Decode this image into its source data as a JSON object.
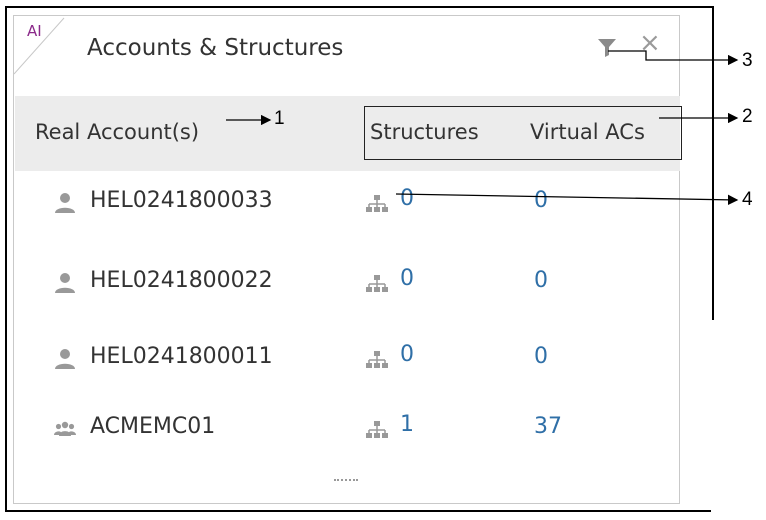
{
  "widget": {
    "badge": "AI",
    "title": "Accounts & Structures"
  },
  "header": {
    "real_accounts": "Real Account(s)",
    "structures": "Structures",
    "virtual_acs": "Virtual ACs"
  },
  "rows": [
    {
      "account": "HEL0241800033",
      "icon": "user-icon",
      "structures": "0",
      "virtual": "0"
    },
    {
      "account": "HEL0241800022",
      "icon": "user-icon",
      "structures": "0",
      "virtual": "0"
    },
    {
      "account": "HEL0241800011",
      "icon": "user-icon",
      "structures": "0",
      "virtual": "0"
    },
    {
      "account": "ACMEMC01",
      "icon": "group-icon",
      "structures": "1",
      "virtual": "37"
    }
  ],
  "callouts": {
    "c1": "1",
    "c2": "2",
    "c3": "3",
    "c4": "4"
  },
  "colors": {
    "link": "#2f6fa7",
    "badge": "#8b2a8a",
    "header_bg": "#ececec",
    "icon_gray": "#999999"
  }
}
